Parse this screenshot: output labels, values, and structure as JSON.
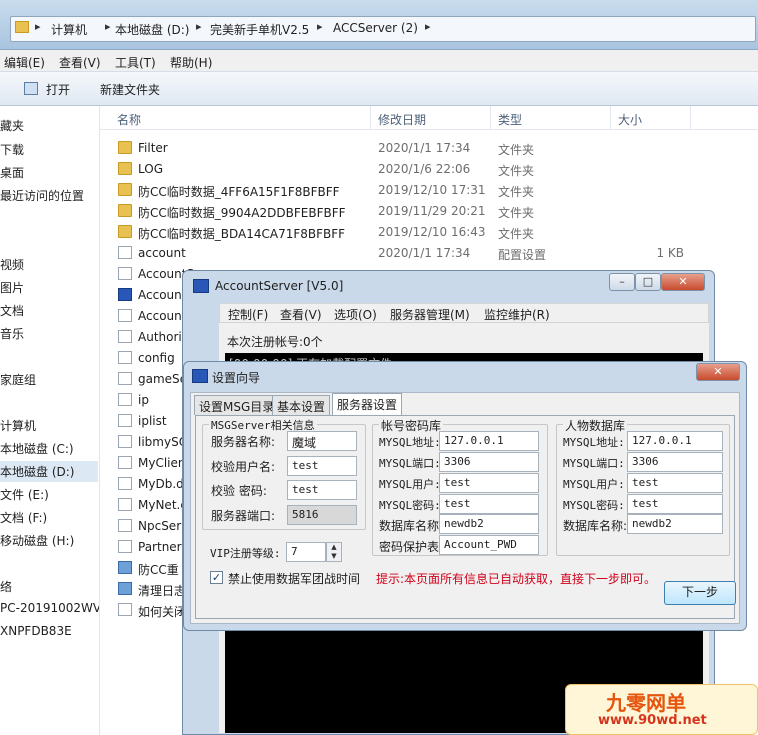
{
  "explorer": {
    "breadcrumb": [
      "计算机",
      "本地磁盘 (D:)",
      "完美新手单机V2.5",
      "ACCServer (2)"
    ],
    "menu": [
      "编辑(E)",
      "查看(V)",
      "工具(T)",
      "帮助(H)"
    ],
    "commands": [
      "打开",
      "新建文件夹"
    ],
    "nav": [
      "藏夹",
      "下载",
      "桌面",
      "最近访问的位置",
      "视频",
      "图片",
      "文档",
      "音乐",
      "家庭组",
      "计算机",
      "本地磁盘 (C:)",
      "本地磁盘 (D:)",
      "文件 (E:)",
      "文档 (F:)",
      "移动磁盘 (H:)",
      "络",
      "PC-20191002WVG",
      "XNPFDB83E"
    ],
    "columns": {
      "name": "名称",
      "date": "修改日期",
      "type": "类型",
      "size": "大小"
    },
    "files": [
      {
        "name": "Filter",
        "date": "2020/1/1 17:34",
        "type": "文件夹",
        "size": "",
        "icon": "folder"
      },
      {
        "name": "LOG",
        "date": "2020/1/6 22:06",
        "type": "文件夹",
        "size": "",
        "icon": "folder"
      },
      {
        "name": "防CC临时数据_4FF6A15F1F8BFBFF",
        "date": "2019/12/10 17:31",
        "type": "文件夹",
        "size": "",
        "icon": "folder"
      },
      {
        "name": "防CC临时数据_9904A2DDBFEBFBFF",
        "date": "2019/11/29 20:21",
        "type": "文件夹",
        "size": "",
        "icon": "folder"
      },
      {
        "name": "防CC临时数据_BDA14CA71F8BFBFF",
        "date": "2019/12/10 16:43",
        "type": "文件夹",
        "size": "",
        "icon": "folder"
      },
      {
        "name": "account",
        "date": "2020/1/1 17:34",
        "type": "配置设置",
        "size": "1 KB",
        "icon": "settings"
      },
      {
        "name": "AccountServer",
        "date": "",
        "type": "",
        "size": "",
        "icon": "dll"
      },
      {
        "name": "AccountServer",
        "date": "",
        "type": "",
        "size": "",
        "icon": "app"
      },
      {
        "name": "AccountServer",
        "date": "",
        "type": "",
        "size": "",
        "icon": "file"
      },
      {
        "name": "AuthorizeDb.",
        "date": "",
        "type": "",
        "size": "",
        "icon": "file"
      },
      {
        "name": "config",
        "date": "",
        "type": "",
        "size": "",
        "icon": "settings"
      },
      {
        "name": "gameSe",
        "date": "",
        "type": "",
        "size": "",
        "icon": "file"
      },
      {
        "name": "ip",
        "date": "",
        "type": "",
        "size": "",
        "icon": "settings"
      },
      {
        "name": "iplist",
        "date": "",
        "type": "",
        "size": "",
        "icon": "file"
      },
      {
        "name": "libmySQ",
        "date": "",
        "type": "",
        "size": "",
        "icon": "dll"
      },
      {
        "name": "MyClien",
        "date": "",
        "type": "",
        "size": "",
        "icon": "dll"
      },
      {
        "name": "MyDb.d",
        "date": "",
        "type": "",
        "size": "",
        "icon": "dll"
      },
      {
        "name": "MyNet.c",
        "date": "",
        "type": "",
        "size": "",
        "icon": "dll"
      },
      {
        "name": "NpcSer",
        "date": "",
        "type": "",
        "size": "",
        "icon": "dll"
      },
      {
        "name": "Partner",
        "date": "",
        "type": "",
        "size": "",
        "icon": "dll"
      },
      {
        "name": "防CC重",
        "date": "",
        "type": "",
        "size": "",
        "icon": "exe"
      },
      {
        "name": "清理日志",
        "date": "",
        "type": "",
        "size": "",
        "icon": "exe"
      },
      {
        "name": "如何关闭",
        "date": "",
        "type": "",
        "size": "",
        "icon": "file"
      }
    ]
  },
  "account_window": {
    "title": "AccountServer [V5.0]",
    "menu": [
      "控制(F)",
      "查看(V)",
      "选项(O)",
      "服务器管理(M)",
      "监控维护(R)"
    ],
    "status": "本次注册帐号:0个",
    "log": "[00:00:00] 正在加载配置文件..."
  },
  "setup_dialog": {
    "title": "设置向导",
    "tabs": [
      "设置MSG目录",
      "基本设置",
      "服务器设置"
    ],
    "msg_group": {
      "title": "MSGServer相关信息",
      "server_name_label": "服务器名称:",
      "server_name": "魔域",
      "verify_user_label": "校验用户名:",
      "verify_user": "test",
      "verify_pass_label": "校验  密码:",
      "verify_pass": "test",
      "port_label": "服务器端口:",
      "port": "5816"
    },
    "vip_label": "VIP注册等级:",
    "vip_value": "7",
    "checkbox_label": "禁止使用数据军团战时间",
    "account_db": {
      "title": "帐号密码库",
      "mysql_addr_label": "MYSQL地址:",
      "mysql_addr": "127.0.0.1",
      "mysql_port_label": "MYSQL端口:",
      "mysql_port": "3306",
      "mysql_user_label": "MYSQL用户:",
      "mysql_user": "test",
      "mysql_pass_label": "MYSQL密码:",
      "mysql_pass": "test",
      "db_name_label": "数据库名称:",
      "db_name": "newdb2",
      "pwd_table_label": "密码保护表:",
      "pwd_table": "Account_PWD"
    },
    "char_db": {
      "title": "人物数据库",
      "mysql_addr_label": "MYSQL地址:",
      "mysql_addr": "127.0.0.1",
      "mysql_port_label": "MYSQL端口:",
      "mysql_port": "3306",
      "mysql_user_label": "MYSQL用户:",
      "mysql_user": "test",
      "mysql_pass_label": "MYSQL密码:",
      "mysql_pass": "test",
      "db_name_label": "数据库名称:",
      "db_name": "newdb2"
    },
    "hint": "提示:本页面所有信息已自动获取，直接下一步即可。",
    "hint_color": "#d0021b",
    "next_button": "下一步"
  },
  "watermark": {
    "line1": "九零网单",
    "line2": "www.90wd.net"
  }
}
